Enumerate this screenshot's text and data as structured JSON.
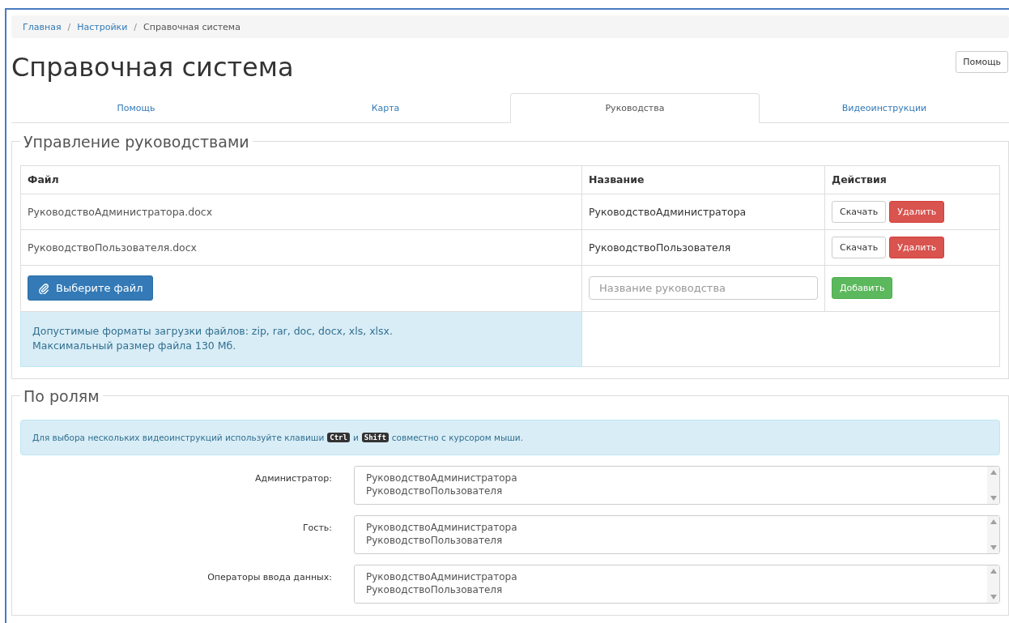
{
  "breadcrumb_separator": "/",
  "breadcrumb": [
    {
      "label": "Главная",
      "link": true
    },
    {
      "label": "Настройки",
      "link": true
    },
    {
      "label": "Справочная система",
      "link": false
    }
  ],
  "title": "Справочная система",
  "help_button": "Помощь",
  "tabs": [
    {
      "label": "Помощь",
      "selected": false
    },
    {
      "label": "Карта",
      "selected": false
    },
    {
      "label": "Руководства",
      "selected": true
    },
    {
      "label": "Видеоинструкции",
      "selected": false
    }
  ],
  "manuals": {
    "legend": "Управление руководствами",
    "columns": [
      "Файл",
      "Название",
      "Действия"
    ],
    "rows": [
      {
        "file": "РуководствоАдминистратора.docx",
        "name": "РуководствоАдминистратора",
        "download": "Скачать",
        "delete": "Удалить"
      },
      {
        "file": "РуководствоПользователя.docx",
        "name": "РуководствоПользователя",
        "download": "Скачать",
        "delete": "Удалить"
      }
    ],
    "choose_file": "Выберите файл",
    "name_field": {
      "placeholder": "Название руководства"
    },
    "add_button": "Добавить",
    "formats_note": [
      "Допустимые форматы загрузки файлов: zip, rar, doc, docx, xls, xlsx.",
      "Максимальный размер файла 130 Мб."
    ]
  },
  "roles": {
    "legend": "По ролям",
    "hint": [
      {
        "kind": "text",
        "text": "Для выбора нескольких видеоинструкций используйте клавиши"
      },
      {
        "kind": "key",
        "text": "Ctrl"
      },
      {
        "kind": "text",
        "text": "и"
      },
      {
        "kind": "key",
        "text": "Shift"
      },
      {
        "kind": "text",
        "text": "совместно с курсором мыши."
      }
    ],
    "items": [
      {
        "label": "Администратор:",
        "options": [
          "РуководствоАдминистратора",
          "РуководствоПользователя"
        ]
      },
      {
        "label": "Гость:",
        "options": [
          "РуководствоАдминистратора",
          "РуководствоПользователя"
        ]
      },
      {
        "label": "Операторы ввода данных:",
        "options": [
          "РуководствоАдминистратора",
          "РуководствоПользователя"
        ]
      }
    ]
  }
}
